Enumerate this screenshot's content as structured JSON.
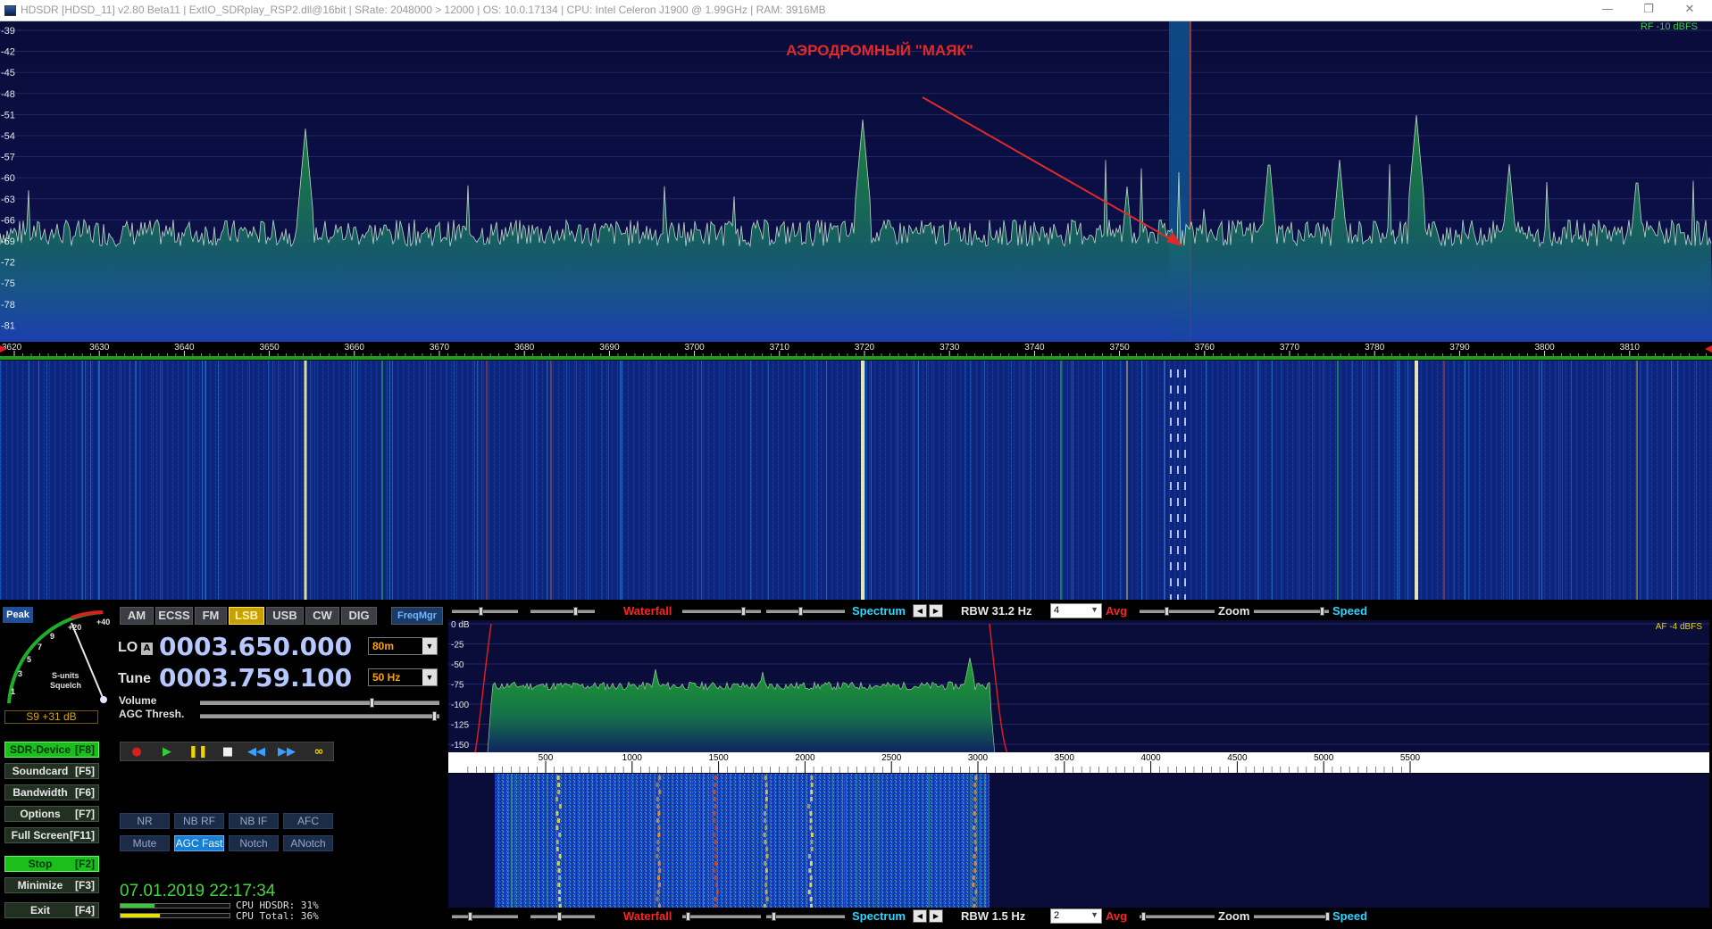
{
  "window": {
    "title": "HDSDR  [HDSD_11]  v2.80 Beta11  |  ExtIO_SDRplay_RSP2.dll@16bit  |  SRate: 2048000 > 12000  |  OS: 10.0.17134  |  CPU: Intel Celeron  J1900  @ 1.99GHz  |  RAM: 3916MB",
    "minimize": "—",
    "restore": "❐",
    "close": "✕"
  },
  "rf_spectrum": {
    "db_labels": [
      "-39",
      "-42",
      "-45",
      "-48",
      "-51",
      "-54",
      "-57",
      "-60",
      "-63",
      "-66",
      "-69",
      "-72",
      "-75",
      "-78",
      "-81"
    ],
    "ref_label": "RF -10 dBFS",
    "annotation": "АЭРОДРОМНЫЙ \"МАЯК\"",
    "freq_labels": [
      "3620",
      "3630",
      "3640",
      "3650",
      "3660",
      "3670",
      "3680",
      "3690",
      "3700",
      "3710",
      "3720",
      "3730",
      "3740",
      "3750",
      "3760",
      "3770",
      "3780",
      "3790",
      "3800",
      "3810"
    ]
  },
  "top_strip": {
    "waterfall": "Waterfall",
    "spectrum": "Spectrum",
    "rbw": "RBW  31.2 Hz",
    "rbw_select": "4",
    "avg": "Avg",
    "zoom": "Zoom",
    "speed": "Speed"
  },
  "bottom_strip": {
    "waterfall": "Waterfall",
    "spectrum": "Spectrum",
    "rbw": "RBW   1.5 Hz",
    "rbw_select": "2",
    "avg": "Avg",
    "zoom": "Zoom",
    "speed": "Speed"
  },
  "af_spectrum": {
    "db_labels": [
      "0 dB",
      "-25",
      "-50",
      "-75",
      "-100",
      "-125",
      "-150"
    ],
    "ref_label": "AF  -4 dBFS",
    "freq_labels": [
      "500",
      "1000",
      "1500",
      "2000",
      "2500",
      "3000",
      "3500",
      "4000",
      "4500",
      "5000",
      "5500"
    ]
  },
  "smeter": {
    "peak": "Peak",
    "scale": [
      "1",
      "3",
      "5",
      "7",
      "9",
      "+20",
      "+40"
    ],
    "caption_1": "S-units",
    "caption_2": "Squelch",
    "reading": "S9 +31 dB"
  },
  "modes": [
    "AM",
    "ECSS",
    "FM",
    "LSB",
    "USB",
    "CW",
    "DIG",
    "FreqMgr"
  ],
  "active_mode": "LSB",
  "lo": {
    "label": "LO",
    "badge": "A",
    "value": "0003.650.000",
    "band": "80m"
  },
  "tune": {
    "label": "Tune",
    "value": "0003.759.100",
    "step": "50 Hz"
  },
  "volume_label": "Volume",
  "agc_label": "AGC Thresh.",
  "side_buttons": [
    {
      "label": "SDR-Device",
      "key": "[F8]"
    },
    {
      "label": "Soundcard",
      "key": "[F5]"
    },
    {
      "label": "Bandwidth",
      "key": "[F6]"
    },
    {
      "label": "Options",
      "key": "[F7]"
    },
    {
      "label": "Full Screen",
      "key": "[F11]"
    },
    {
      "label": "Stop",
      "key": "[F2]"
    },
    {
      "label": "Minimize",
      "key": "[F3]"
    },
    {
      "label": "Exit",
      "key": "[F4]"
    }
  ],
  "dsp_buttons": [
    "NR",
    "NB RF",
    "NB IF",
    "AFC",
    "Mute",
    "AGC Fast",
    "Notch",
    "ANotch"
  ],
  "clock": "07.01.2019 22:17:34",
  "cpu": {
    "hdsdr": "CPU HDSDR: 31%",
    "total": "CPU Total: 36%",
    "hdsdr_fraction": 0.31,
    "total_fraction": 0.36
  },
  "colors": {
    "spectrum_bg": "#0b0e3e",
    "waterfall_bg": "#0a1a5c",
    "accent_green": "#3fd13a",
    "annotation_red": "#e02a2a"
  }
}
